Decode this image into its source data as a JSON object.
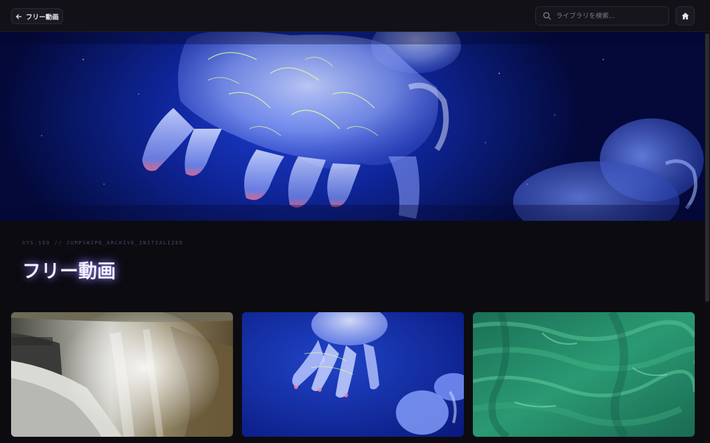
{
  "topbar": {
    "back_label": "フリー動画",
    "search_placeholder": "ライブラリを検索..."
  },
  "page": {
    "sequence_text": "SYS.SEQ // JUMPSWIPE_ARCHIVE_INITIALIZED",
    "title": "フリー動画"
  },
  "icons": {
    "back": "arrow-left-icon",
    "search": "search-icon",
    "home": "home-icon"
  },
  "colors": {
    "background": "#0c0b10",
    "title_glow": "#968cff",
    "hero_blue": "#0f2599"
  },
  "videos": [
    {
      "subject": "waterfall"
    },
    {
      "subject": "jellyfish"
    },
    {
      "subject": "green-water"
    }
  ]
}
